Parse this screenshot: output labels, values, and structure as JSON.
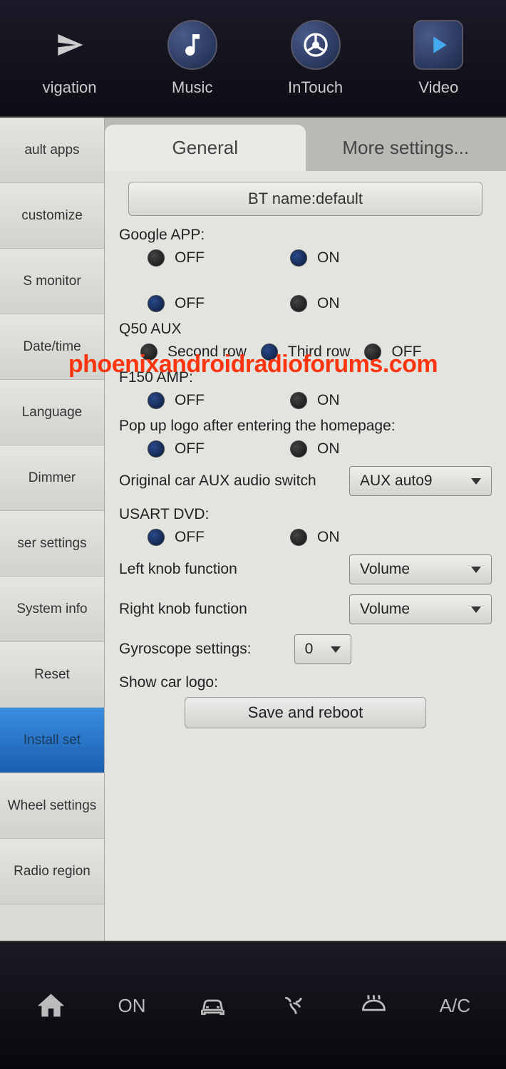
{
  "watermark": "phoenixandroidradioforums.com",
  "topNav": {
    "items": [
      {
        "label": "vigation",
        "icon": "plane"
      },
      {
        "label": "Music",
        "icon": "music"
      },
      {
        "label": "InTouch",
        "icon": "wheel"
      },
      {
        "label": "Video",
        "icon": "play"
      }
    ]
  },
  "sidebar": {
    "items": [
      {
        "label": "ault apps"
      },
      {
        "label": "customize"
      },
      {
        "label": "S monitor"
      },
      {
        "label": "Date/time"
      },
      {
        "label": "Language"
      },
      {
        "label": "Dimmer"
      },
      {
        "label": "ser settings"
      },
      {
        "label": "System info"
      },
      {
        "label": "Reset"
      },
      {
        "label": "Install set",
        "active": true
      },
      {
        "label": "Wheel settings"
      },
      {
        "label": "Radio region"
      }
    ]
  },
  "tabs": {
    "general": "General",
    "more": "More settings..."
  },
  "settings": {
    "btName": "BT name:default",
    "googleApp": {
      "label": "Google APP:",
      "off": "OFF",
      "on": "ON"
    },
    "row2": {
      "off": "OFF",
      "on": "ON"
    },
    "q50Aux": {
      "label": "Q50 AUX",
      "opt1": "Second row",
      "opt2": "Third row",
      "opt3": "OFF"
    },
    "f150Amp": {
      "label": "F150 AMP:",
      "off": "OFF",
      "on": "ON"
    },
    "popupLogo": {
      "label": "Pop up logo after entering the homepage:",
      "off": "OFF",
      "on": "ON"
    },
    "auxSwitch": {
      "label": "Original car AUX audio switch",
      "value": "AUX auto9"
    },
    "usartDvd": {
      "label": "USART DVD:",
      "off": "OFF",
      "on": "ON"
    },
    "leftKnob": {
      "label": "Left knob function",
      "value": "Volume"
    },
    "rightKnob": {
      "label": "Right knob function",
      "value": "Volume"
    },
    "gyroscope": {
      "label": "Gyroscope settings:",
      "value": "0"
    },
    "showLogo": "Show car logo:",
    "saveReboot": "Save and reboot"
  },
  "bottomBar": {
    "on": "ON",
    "ac": "A/C"
  }
}
